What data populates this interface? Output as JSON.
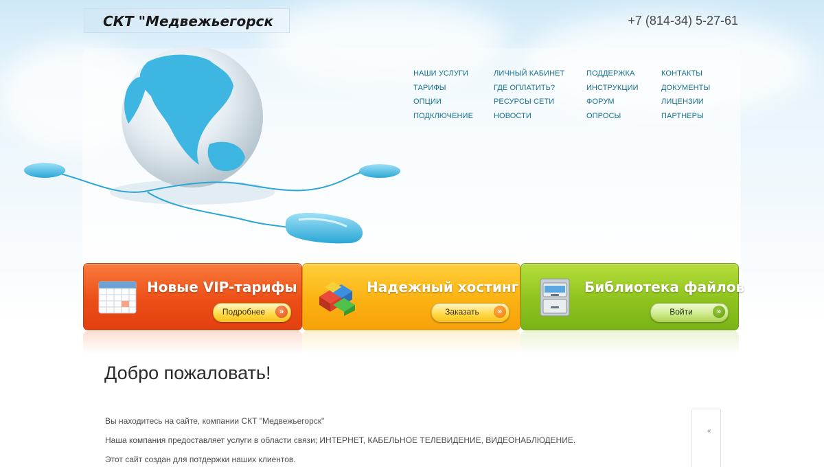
{
  "header": {
    "logo_text": "СКТ \"Медвежьегорск",
    "phone": "+7 (814-34) 5-27-61"
  },
  "nav": {
    "columns": [
      [
        "НАШИ УСЛУГИ",
        "ТАРИФЫ",
        "ОПЦИИ",
        "ПОДКЛЮЧЕНИЕ"
      ],
      [
        "ЛИЧНЫЙ КАБИНЕТ",
        "ГДЕ ОПЛАТИТЬ?",
        "РЕСУРСЫ СЕТИ",
        "НОВОСТИ"
      ],
      [
        "ПОДДЕРЖКА",
        "ИНСТРУКЦИИ",
        "ФОРУМ",
        "ОПРОСЫ"
      ],
      [
        "КОНТАКТЫ",
        "ДОКУМЕНТЫ",
        "ЛИЦЕНЗИИ",
        "ПАРТНЕРЫ"
      ]
    ]
  },
  "banners": [
    {
      "title": "Новые VIP-тарифы",
      "button": "Подробнее",
      "icon": "calendar-icon",
      "color": "#ec4e16"
    },
    {
      "title": "Надежный хостинг",
      "button": "Заказать",
      "icon": "puzzle-cubes-icon",
      "color": "#fbb212"
    },
    {
      "title": "Библиотека файлов",
      "button": "Войти",
      "icon": "file-cabinet-icon",
      "color": "#8fc31e"
    }
  ],
  "main": {
    "heading": "Добро пожаловать!",
    "paragraphs": [
      "Вы находитесь на сайте, компании СКТ \"Медвежьегорск\"",
      "Наша компания предоставляет услуги в области связи; ИНТЕРНЕТ, КАБЕЛЬНОЕ ТЕЛЕВИДЕНИЕ, ВИДЕОНАБЛЮДЕНИЕ.",
      "Этот сайт создан для потдержки наших клиентов."
    ],
    "side_box_mark": "«"
  }
}
